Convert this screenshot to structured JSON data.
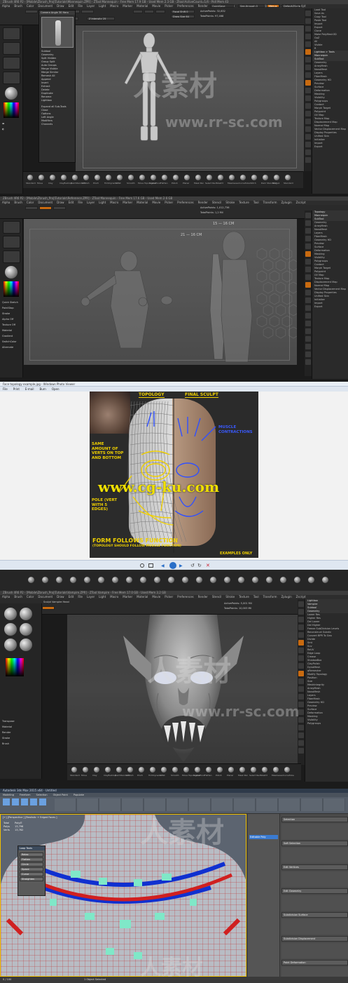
{
  "panel1": {
    "title": "ZBrush 4R6 P2 - [Mobile\\Zbrush_Proj\\Tutorials\\Mannequin.ZPR] - ZTool:Mannequin - Free Mem 17.9 GB - Used Mem 2.3 GB - Ztool:ActiveCount=1/4 - Poll Mem 43",
    "menus": [
      "Alpha",
      "Brush",
      "Color",
      "Document",
      "Draw",
      "Edit",
      "File",
      "Layer",
      "Light",
      "Macro",
      "Marker",
      "Material",
      "Movie",
      "Picker",
      "Preferences",
      "Render",
      "Stencil",
      "Stroke",
      "Texture",
      "Tool",
      "Transform",
      "Zplugin",
      "Zscript"
    ],
    "quicksave": "QuickSave",
    "see_through": "See-through 0",
    "menus_btn": "Menus",
    "default_script": "DefaultZScript",
    "tool_label": "Tool",
    "popup_title": "Camera Angle 30 Hero",
    "popup_items": [
      "Subtool",
      "Geometry",
      "Split Hidden",
      "Group Split",
      "Auto Groups",
      "Merge Visible",
      "Merge Similar",
      "Remesh All",
      "Append",
      "Insert",
      "Extract",
      "Delete",
      "Duplicate",
      "Rename",
      "Lightbox"
    ],
    "popup_lower": [
      "Expand all Sub-Tools",
      "Close",
      "Options",
      "Left Angle",
      "Modifiers",
      "Channels"
    ],
    "focal_shift": "Focal Shift 0",
    "draw_size": "Draw Size 64",
    "z_intensity": "Z Intensity 25",
    "active_points": "ActivePoints: 32,832",
    "total_points": "TotalPoints: 97,468",
    "rgb_intensity": "Rgb Intensity 100",
    "right_items": [
      "Load Tool",
      "Save As",
      "Copy Tool",
      "Paste Tool",
      "Import",
      "Export",
      "Clone",
      "Make PolyMesh3D",
      "GoZ",
      "All",
      "Visible",
      "R",
      "Lightbox > Tools",
      "Mannequin",
      "SubTool",
      "Geometry",
      "ArrayMesh",
      "NanoMesh",
      "Layers",
      "FiberMesh",
      "Geometry HD",
      "Preview",
      "Surface",
      "Deformation",
      "Masking",
      "Visibility",
      "Polygroups",
      "Contact",
      "Morph Target",
      "Polypaint",
      "UV Map",
      "Texture Map",
      "Displacement Map",
      "Normal Map",
      "Vector Displacement Map",
      "Display Properties",
      "Unified Skin",
      "Initialize",
      "Import",
      "Export"
    ],
    "brush_labels": [
      "Standard",
      "Move",
      "Clay",
      "ClayBuildup",
      "DamStandard",
      "hPolish",
      "Pinch",
      "TrimDynamic",
      "Inflat",
      "Smooth",
      "Move Topological",
      "SnakeHook",
      "Flatten",
      "Polish",
      "Planar",
      "Mask Pen",
      "Select Rect",
      "Slash3",
      "MaskLasso",
      "CurveTube",
      "Stitch",
      "Dam Standard",
      "Stage1",
      "Standard"
    ],
    "watermark": "人素材",
    "watermark_url": "www.rr-sc.com"
  },
  "panel2": {
    "title": "ZBrush 4R6 P2 - [Mobile\\Zbrush_Proj\\Tutorials\\Reference.ZPR] - ZTool:Mannequin - Free Mem 17.6 GB - Used Mem 2.6 GB",
    "active_points": "ActivePoints: 1,012,736",
    "total_points": "TotalPoints: 1,2 Mil",
    "ruler_a": "21 — 16 CM",
    "ruler_b": "15 — 16 CM",
    "right_items": [
      "Topology",
      "Mannequin",
      "SubTool",
      "Geometry",
      "ArrayMesh",
      "NanoMesh",
      "Layers",
      "FiberMesh",
      "Geometry HD",
      "Preview",
      "Surface",
      "Deformation",
      "Masking",
      "Visibility",
      "Polygroups",
      "Contact",
      "Morph Target",
      "Polypaint",
      "UV Map",
      "Texture Map",
      "Displacement Map",
      "Normal Map",
      "Vector Displacement Map",
      "Display Properties",
      "Unified Skin",
      "Initialize",
      "Import",
      "Export"
    ],
    "side_labels": [
      "Quick Sketch",
      "PaintStop",
      "Stroke",
      "Alpha Off",
      "Texture Off",
      "Material",
      "Gradient",
      "SwitchColor",
      "Alternate"
    ]
  },
  "panel3": {
    "window_title": "Face topology example.jpg - Windows Photo Viewer",
    "menu_items": [
      "File",
      "Print",
      "E-mail",
      "Burn",
      "Open"
    ],
    "topology_label": "TOPOLOGY",
    "final_label": "FINAL SCULPT",
    "note_left": "SAME AMOUNT OF VERTS ON TOP AND BOTTOM",
    "note_pole": "POLE (VERT WITH 5 EDGES)",
    "note_muscle": "MUSCLE CONTRACTIONS",
    "headline": "FORM FOLLOWS FUNCTION",
    "subline": "(TOPOLOGY SHOULD FOLLOW MUSCLE FUNCTION)",
    "examples": "EXAMPLES ONLY",
    "overlay_url": "www.cg-ku.com"
  },
  "panel4": {
    "title": "ZBrush 4R6 P2 - [Mobile\\Zbrush_Proj\\Tutorials\\Vampire.ZPR] - ZTool:Vampire - Free Mem 17.0 GB - Used Mem 3.2 GB",
    "sub_tool": "Sculpt Vampire Head",
    "active_points": "ActivePoints: 5,001 Mil",
    "total_points": "TotalPoints: 10,003 Mil",
    "right_items": [
      "Lightbox",
      "Vampire",
      "Subtool",
      "Geometry",
      "Lower Res",
      "Higher Res",
      "Del Lower",
      "Del Higher",
      "Freeze SubDivision Levels",
      "Reconstruct Subdiv",
      "Convert BPR To Geo",
      "Divide",
      "Smt",
      "Suv",
      "ReUV",
      "Edge Loop",
      "Crease",
      "ShadowBox",
      "ClayPolish",
      "DynaMesh",
      "qRemesher",
      "Modify Topology",
      "Position",
      "Size",
      "MeshIntegrity",
      "ArrayMesh",
      "NanoMesh",
      "Layers",
      "FiberMesh",
      "Geometry HD",
      "Preview",
      "Surface",
      "Deformation",
      "Masking",
      "Visibility",
      "Polygroups"
    ],
    "left_lower": [
      "Transpose",
      "Material",
      "Render",
      "Stroke",
      "Brush"
    ]
  },
  "panel5": {
    "title": "Autodesk 3ds Max 2015 x64 - Untitled",
    "viewport_label": "[+] [Perspective ] [Realistic + Edged Faces ]",
    "stats_rows": [
      [
        "Total",
        "Poly/E"
      ],
      [
        "Polys",
        "13,798"
      ],
      [
        "Verts",
        "13,762"
      ]
    ],
    "loop_tools": "Loop Tools",
    "loop_rows": [
      "Relax",
      "Flatten",
      "Circle",
      "Space",
      "Curve",
      "Straighten"
    ],
    "modifier": "Editable Poly",
    "ribbon": [
      "Modeling",
      "Freeform",
      "Selection",
      "Object Paint",
      "Populate"
    ],
    "right_rollouts": [
      "Selection",
      "Soft Selection",
      "Edit Vertices",
      "Edit Geometry",
      "Subdivision Surface",
      "Subdivision Displacement",
      "Paint Deformation"
    ],
    "status": "1 Object Selected",
    "time_range": "0 / 100"
  }
}
